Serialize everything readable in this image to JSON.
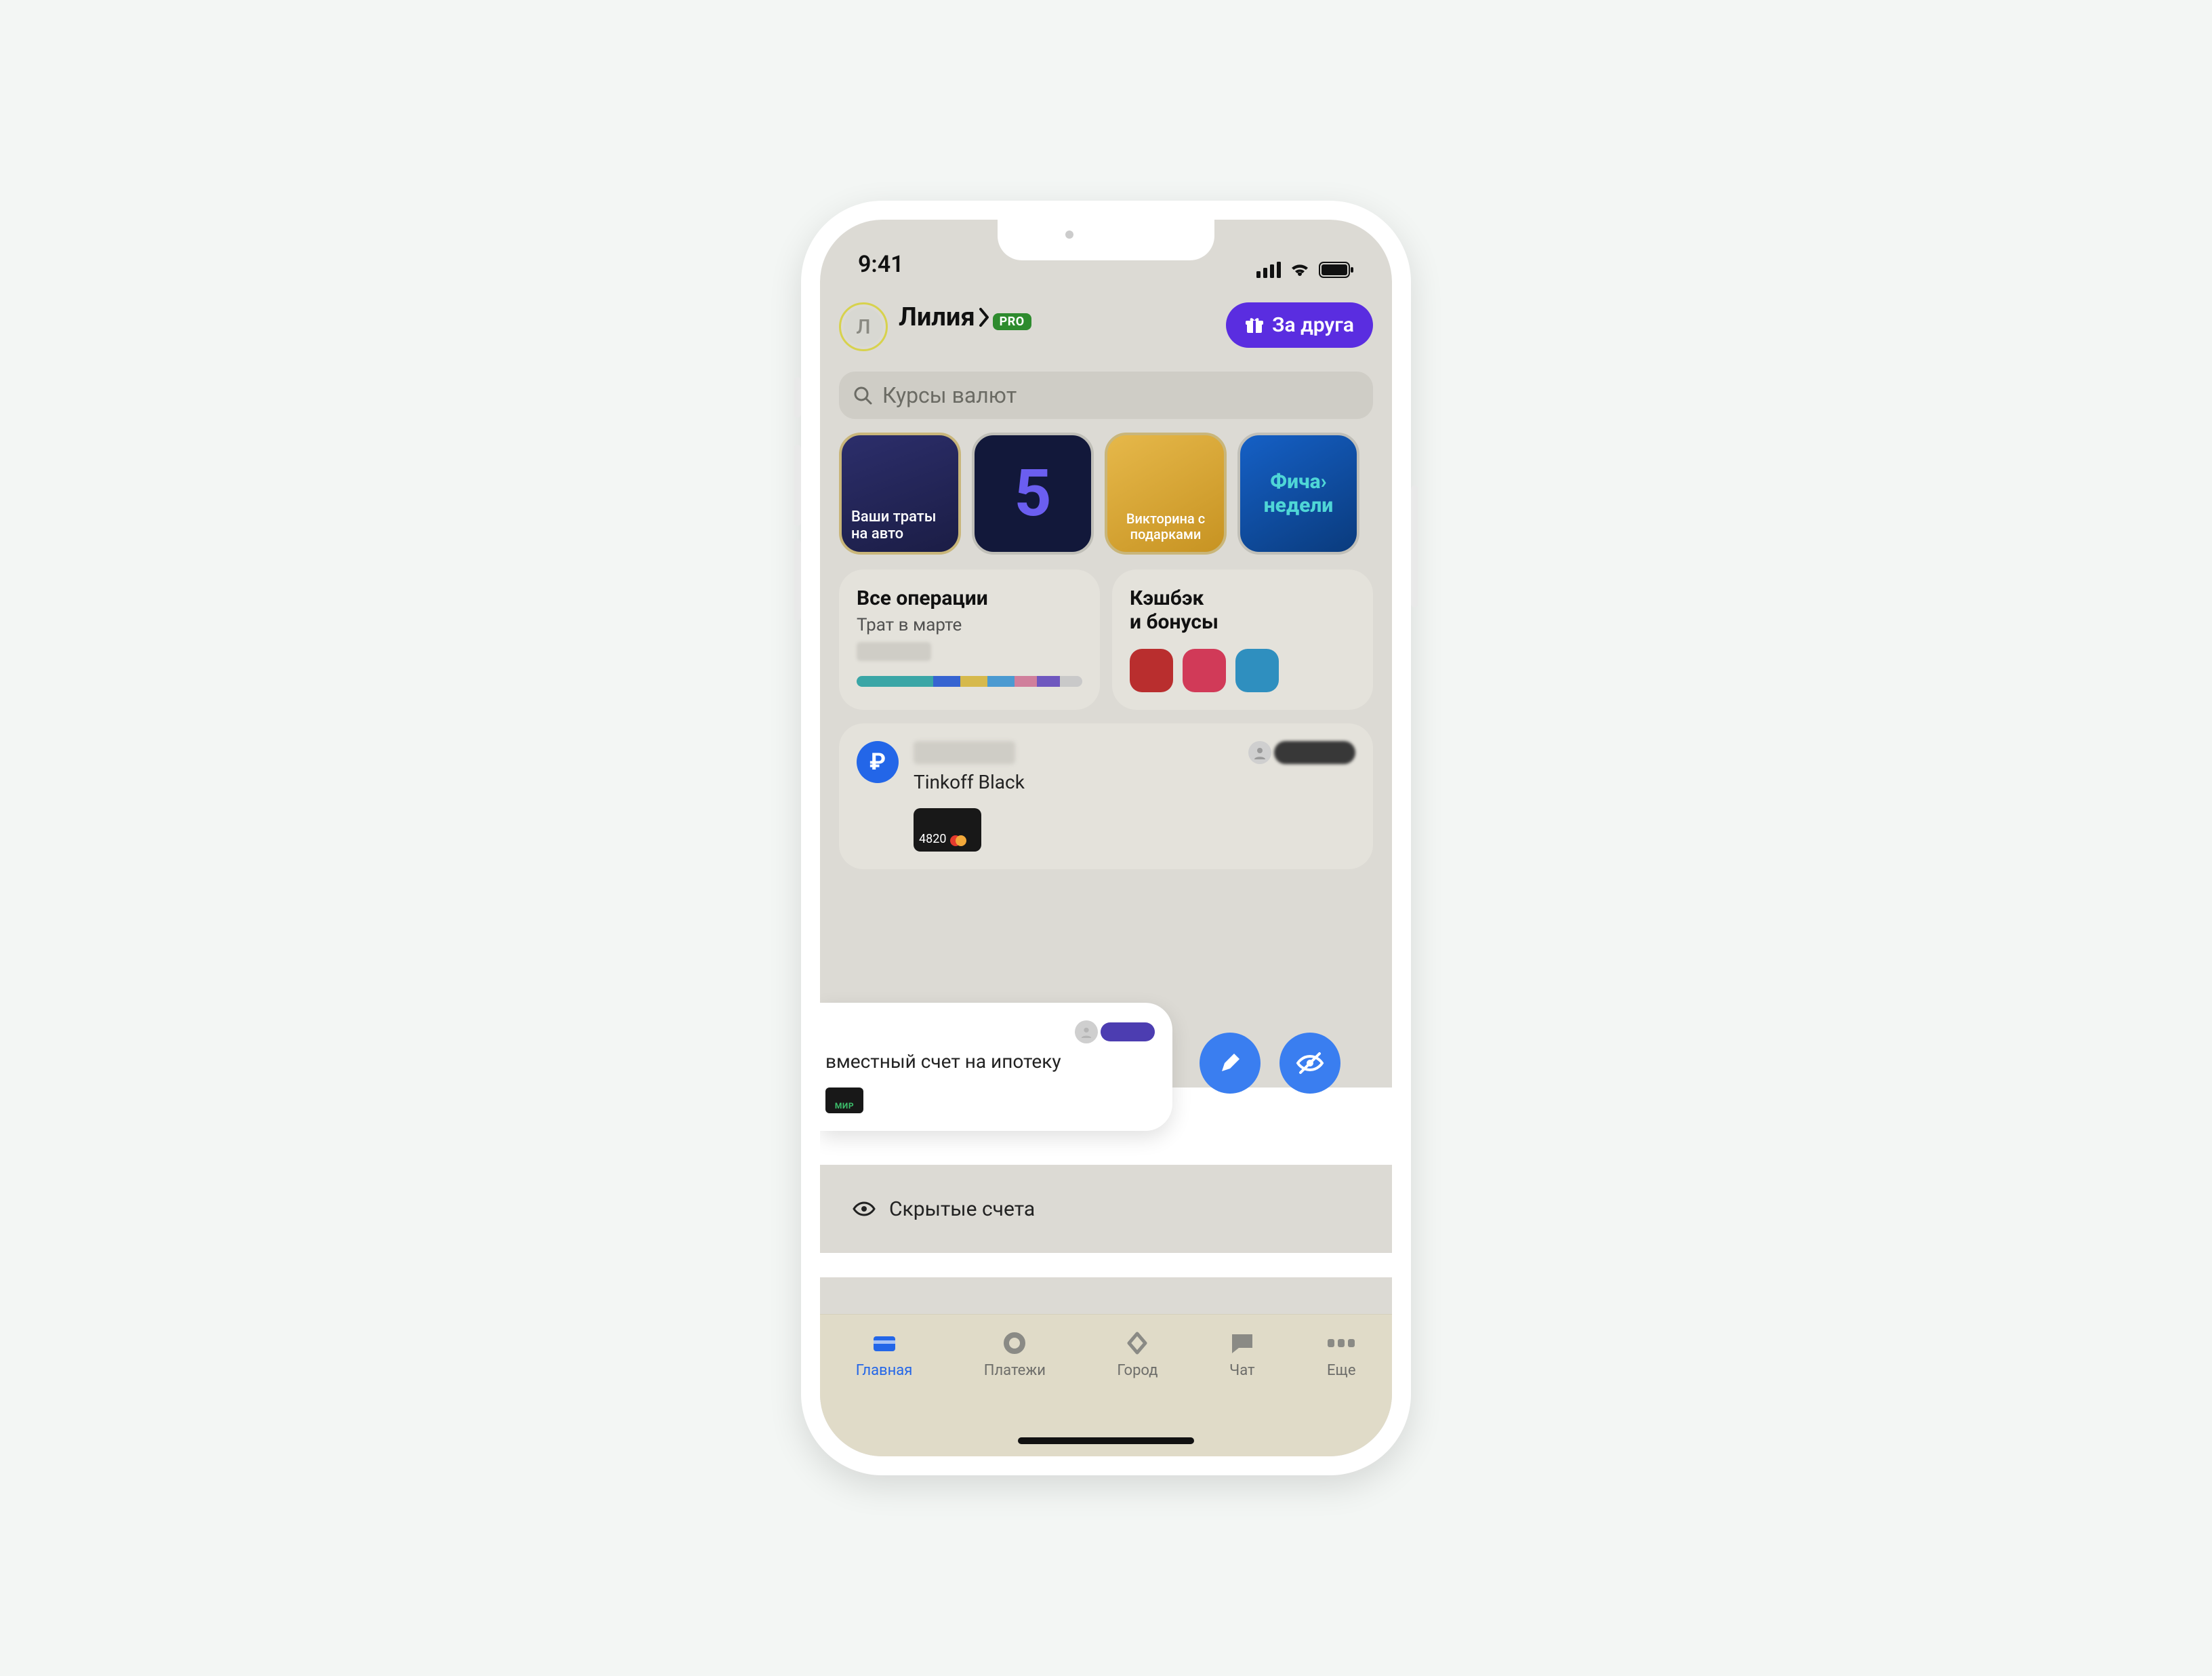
{
  "status": {
    "time": "9:41"
  },
  "header": {
    "name": "Лилия",
    "avatar_letter": "Л",
    "pro_badge": "PRO",
    "friend_button": "За друга"
  },
  "search": {
    "placeholder": "Курсы валют"
  },
  "stories": [
    {
      "label": "Ваши траты на авто"
    },
    {
      "label": "5"
    },
    {
      "label": "Викторина с подарками"
    },
    {
      "label": "Фича› недели"
    }
  ],
  "ops": {
    "title": "Все операции",
    "subtitle": "Трат в марте",
    "segments": [
      {
        "color": "#3aa6a6",
        "pct": 34
      },
      {
        "color": "#3664d1",
        "pct": 12
      },
      {
        "color": "#d6b94c",
        "pct": 12
      },
      {
        "color": "#4b9ad1",
        "pct": 12
      },
      {
        "color": "#d07f9c",
        "pct": 10
      },
      {
        "color": "#6f58bf",
        "pct": 10
      },
      {
        "color": "#c9c9c9",
        "pct": 10
      }
    ]
  },
  "cashback": {
    "title": "Кэшбэк и бонусы",
    "squares": [
      "#b92e2e",
      "#d13a58",
      "#2f8fbf"
    ]
  },
  "account": {
    "label": "Tinkoff Black",
    "card_last4": "4820"
  },
  "swipe_card": {
    "label": "вместный счет на ипотеку",
    "scheme": "МИР"
  },
  "hidden_accounts": {
    "label": "Скрытые счета"
  },
  "tabs": [
    {
      "id": "home",
      "label": "Главная",
      "active": true
    },
    {
      "id": "payments",
      "label": "Платежи",
      "active": false
    },
    {
      "id": "city",
      "label": "Город",
      "active": false
    },
    {
      "id": "chat",
      "label": "Чат",
      "active": false
    },
    {
      "id": "more",
      "label": "Еще",
      "active": false
    }
  ]
}
